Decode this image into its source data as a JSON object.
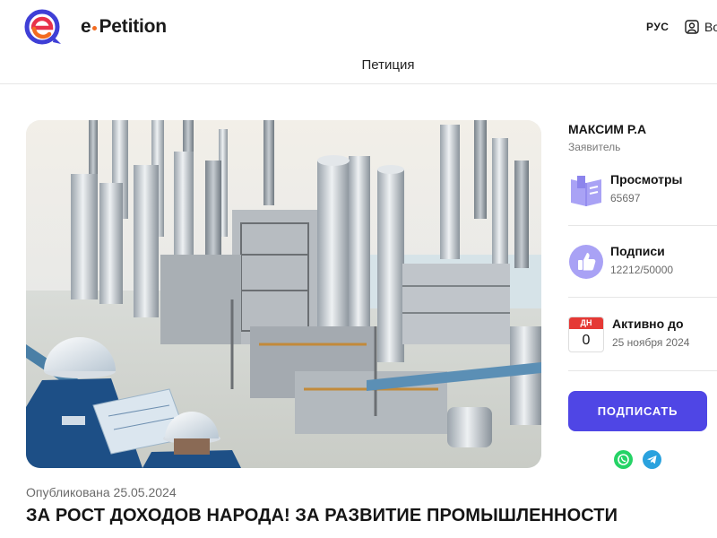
{
  "header": {
    "brand_prefix": "e",
    "brand_name": "Petition",
    "language": "РУС",
    "login_label": "Войти",
    "nav_petition": "Петиция"
  },
  "petition": {
    "published": "Опубликована 25.05.2024",
    "title": "ЗА РОСТ ДОХОДОВ НАРОДА! ЗА РАЗВИТИЕ ПРОМЫШЛЕННОСТИ"
  },
  "author": {
    "name": "МАКСИМ Р.А",
    "role": "Заявитель"
  },
  "stats": {
    "views_label": "Просмотры",
    "views_value": "65697",
    "signatures_label": "Подписи",
    "signatures_value": "12212/50000",
    "active_label": "Активно до",
    "active_value": "25 ноября 2024",
    "days_label": "ДН",
    "days_value": "0"
  },
  "actions": {
    "sign_label": "ПОДПИСАТЬ"
  },
  "icons": {
    "logo": "e-petition-logo",
    "user": "user-icon",
    "views": "views-icon",
    "signatures": "thumbs-up-icon",
    "calendar": "calendar-icon",
    "whatsapp": "whatsapp-icon",
    "telegram": "telegram-icon"
  },
  "colors": {
    "accent": "#4f46e5",
    "logo_blue": "#3f3fd6",
    "logo_orange": "#f26b21",
    "logo_red": "#e8314a",
    "stat_icon": "#a9a2f5",
    "calendar_red": "#e53935",
    "whatsapp": "#25d366",
    "telegram": "#2aa2de"
  }
}
